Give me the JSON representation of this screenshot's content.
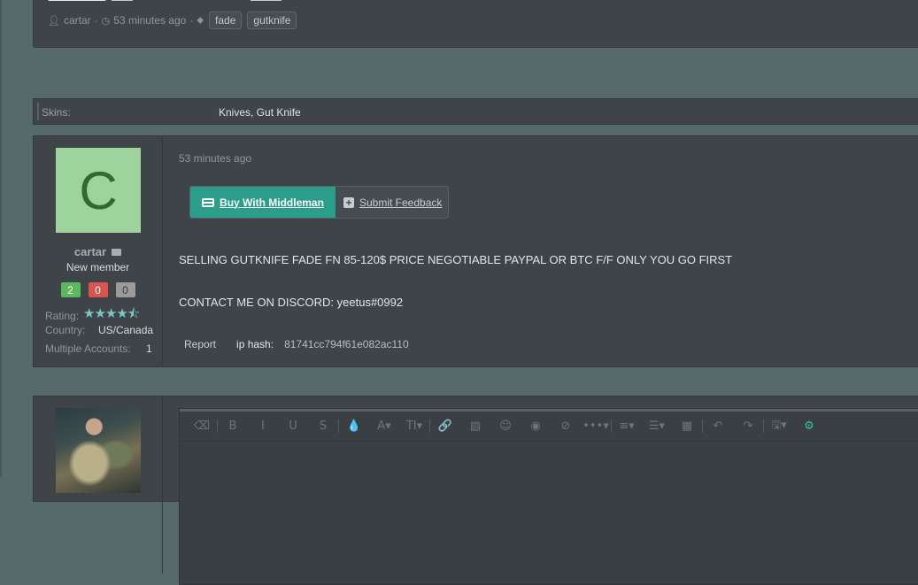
{
  "top_post": {
    "author": "cartar",
    "time": "53 minutes ago",
    "tags": [
      "fade",
      "gutknife"
    ]
  },
  "skins": {
    "label": "Skins:",
    "value": "Knives, Gut Knife"
  },
  "post": {
    "time": "53 minutes ago",
    "user": {
      "avatar_letter": "C",
      "avatar_color": "#9fd39c",
      "username": "cartar",
      "title": "New member",
      "badges": [
        {
          "value": "2",
          "bg": "#5cb85c",
          "fg": "#ffffff"
        },
        {
          "value": "0",
          "bg": "#d9534f",
          "fg": "#ffffff"
        },
        {
          "value": "0",
          "bg": "#9a9a9a",
          "fg": "#3c3c3c"
        }
      ],
      "rating_label": "Rating:",
      "rating_stars": 4.5,
      "country_label": "Country:",
      "country_value": "US/Canada",
      "accounts_label": "Multiple Accounts:",
      "accounts_value": "1"
    },
    "buttons": {
      "middleman": "Buy With Middleman",
      "feedback": "Submit Feedback"
    },
    "message_lines": [
      "SELLING GUTKNIFE FADE FN 85-120$ PRICE NEGOTIABLE PAYPAL OR BTC F/F ONLY YOU GO FIRST",
      "CONTACT ME ON DISCORD: yeetus#0992"
    ],
    "footer": {
      "report": "Report",
      "ip_label": "ip hash:",
      "ip_value": "81741cc794f61e082ac110"
    }
  },
  "editor": {
    "toolbar": [
      {
        "name": "eraser-icon",
        "glyph": "⌫"
      },
      {
        "name": "bold-icon",
        "glyph": "B"
      },
      {
        "name": "italic-icon",
        "glyph": "I"
      },
      {
        "name": "underline-icon",
        "glyph": "U"
      },
      {
        "name": "strikethrough-icon",
        "glyph": "S"
      },
      {
        "name": "color-icon",
        "glyph": "💧"
      },
      {
        "name": "font-icon",
        "glyph": "A▾"
      },
      {
        "name": "font-size-icon",
        "glyph": "TI▾"
      },
      {
        "name": "link-icon",
        "glyph": "🔗"
      },
      {
        "name": "image-icon",
        "glyph": "▨"
      },
      {
        "name": "smiley-icon",
        "glyph": "☺"
      },
      {
        "name": "spoiler-icon",
        "glyph": "◉"
      },
      {
        "name": "hide-icon",
        "glyph": "⊘"
      },
      {
        "name": "more-icon",
        "glyph": "•••▾"
      },
      {
        "name": "align-icon",
        "glyph": "≡▾"
      },
      {
        "name": "list-icon",
        "glyph": "☰▾"
      },
      {
        "name": "table-icon",
        "glyph": "▦"
      },
      {
        "name": "undo-icon",
        "glyph": "↶"
      },
      {
        "name": "redo-icon",
        "glyph": "↷"
      },
      {
        "name": "save-draft-icon",
        "glyph": "🖫▾"
      },
      {
        "name": "settings-icon",
        "glyph": "⚙"
      }
    ],
    "active_color": "#3cc492"
  }
}
